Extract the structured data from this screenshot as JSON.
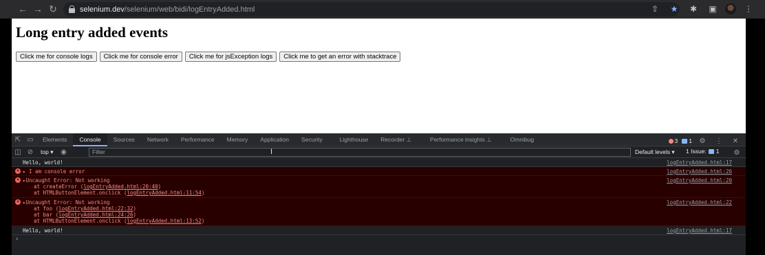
{
  "browser": {
    "url_host": "selenium.dev",
    "url_path": "/selenium/web/bidi/logEntryAdded.html"
  },
  "page": {
    "heading": "Long entry added events",
    "buttons": [
      "Click me for console logs",
      "Click me for console error",
      "Click me for jsException logs",
      "Click me to get an error with stacktrace"
    ]
  },
  "devtools": {
    "tabs": [
      "Elements",
      "Console",
      "Sources",
      "Network",
      "Performance",
      "Memory",
      "Application",
      "Security",
      "Lighthouse",
      "Recorder",
      "Performance insights",
      "Omnibug"
    ],
    "active_tab": "Console",
    "error_count": "3",
    "issue_count": "1",
    "context": "top",
    "filter_placeholder": "Filter",
    "levels": "Default levels",
    "issues_label": "1 Issue:",
    "issues_num": "1"
  },
  "console": {
    "messages": [
      {
        "type": "log",
        "text": "Hello, world!",
        "source": "logEntryAdded.html:17"
      },
      {
        "type": "error",
        "text": "I am console error",
        "source": "logEntryAdded.html:26"
      },
      {
        "type": "error",
        "text": "Uncaught Error: Not working",
        "source": "logEntryAdded.html:20",
        "stack": [
          {
            "prefix": "at createError (",
            "link": "logEntryAdded.html:20:40",
            "suffix": ")"
          },
          {
            "prefix": "at HTMLButtonElement.onclick (",
            "link": "logEntryAdded.html:11:54",
            "suffix": ")"
          }
        ]
      },
      {
        "type": "error",
        "text": "Uncaught Error: Not working",
        "source": "logEntryAdded.html:22",
        "stack": [
          {
            "prefix": "at foo (",
            "link": "logEntryAdded.html:22:32",
            "suffix": ")"
          },
          {
            "prefix": "at bar (",
            "link": "logEntryAdded.html:24:26",
            "suffix": ")"
          },
          {
            "prefix": "at HTMLButtonElement.onclick (",
            "link": "logEntryAdded.html:13:52",
            "suffix": ")"
          }
        ]
      },
      {
        "type": "log",
        "text": "Hello, world!",
        "source": "logEntryAdded.html:17"
      }
    ]
  }
}
